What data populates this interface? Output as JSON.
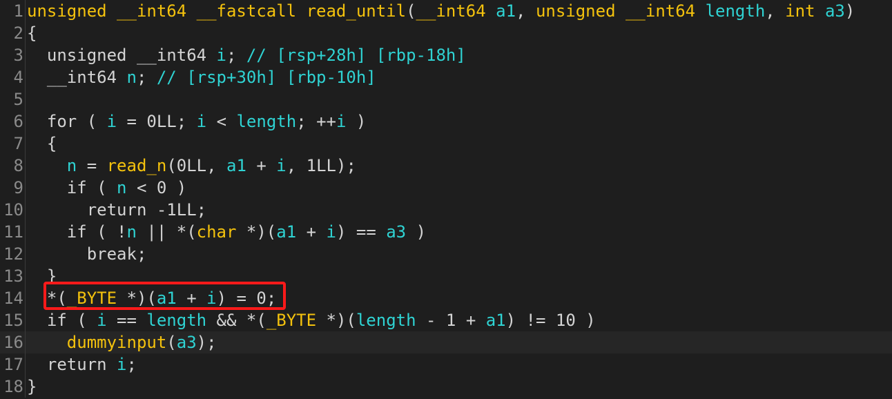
{
  "lines": [
    {
      "num": "1",
      "tokens": [
        [
          "t",
          "unsigned __int64 __fastcall read_until"
        ],
        [
          "p",
          "("
        ],
        [
          "t",
          "__int64 "
        ],
        [
          "v",
          "a1"
        ],
        [
          "p",
          ", "
        ],
        [
          "t",
          "unsigned __int64 "
        ],
        [
          "v",
          "length"
        ],
        [
          "p",
          ", "
        ],
        [
          "t",
          "int "
        ],
        [
          "v",
          "a3"
        ],
        [
          "p",
          ")"
        ]
      ]
    },
    {
      "num": "2",
      "tokens": [
        [
          "p",
          "{"
        ]
      ]
    },
    {
      "num": "3",
      "tokens": [
        [
          "k",
          "  unsigned __int64 "
        ],
        [
          "v",
          "i"
        ],
        [
          "p",
          "; "
        ],
        [
          "c",
          "// [rsp+28h] [rbp-18h]"
        ]
      ]
    },
    {
      "num": "4",
      "tokens": [
        [
          "k",
          "  __int64 "
        ],
        [
          "v",
          "n"
        ],
        [
          "p",
          "; "
        ],
        [
          "c",
          "// [rsp+30h] [rbp-10h]"
        ]
      ]
    },
    {
      "num": "5",
      "tokens": []
    },
    {
      "num": "6",
      "tokens": [
        [
          "k",
          "  for ( "
        ],
        [
          "v",
          "i"
        ],
        [
          "p",
          " = "
        ],
        [
          "n",
          "0LL"
        ],
        [
          "p",
          "; "
        ],
        [
          "v",
          "i"
        ],
        [
          "p",
          " < "
        ],
        [
          "v",
          "length"
        ],
        [
          "p",
          "; ++"
        ],
        [
          "v",
          "i"
        ],
        [
          "p",
          " )"
        ]
      ]
    },
    {
      "num": "7",
      "tokens": [
        [
          "p",
          "  {"
        ]
      ]
    },
    {
      "num": "8",
      "tokens": [
        [
          "p",
          "    "
        ],
        [
          "v",
          "n"
        ],
        [
          "p",
          " = "
        ],
        [
          "t",
          "read_n"
        ],
        [
          "p",
          "("
        ],
        [
          "n",
          "0LL"
        ],
        [
          "p",
          ", "
        ],
        [
          "v",
          "a1"
        ],
        [
          "p",
          " + "
        ],
        [
          "v",
          "i"
        ],
        [
          "p",
          ", "
        ],
        [
          "n",
          "1LL"
        ],
        [
          "p",
          ");"
        ]
      ]
    },
    {
      "num": "9",
      "tokens": [
        [
          "k",
          "    if ( "
        ],
        [
          "v",
          "n"
        ],
        [
          "p",
          " < "
        ],
        [
          "n",
          "0"
        ],
        [
          "p",
          " )"
        ]
      ]
    },
    {
      "num": "10",
      "tokens": [
        [
          "k",
          "      return "
        ],
        [
          "n",
          "-1LL"
        ],
        [
          "p",
          ";"
        ]
      ]
    },
    {
      "num": "11",
      "tokens": [
        [
          "k",
          "    if ( !"
        ],
        [
          "v",
          "n"
        ],
        [
          "p",
          " || *("
        ],
        [
          "t",
          "char"
        ],
        [
          "p",
          " *)("
        ],
        [
          "v",
          "a1"
        ],
        [
          "p",
          " + "
        ],
        [
          "v",
          "i"
        ],
        [
          "p",
          ") == "
        ],
        [
          "v",
          "a3"
        ],
        [
          "p",
          " )"
        ]
      ]
    },
    {
      "num": "12",
      "tokens": [
        [
          "k",
          "      break"
        ],
        [
          "p",
          ";"
        ]
      ]
    },
    {
      "num": "13",
      "tokens": [
        [
          "p",
          "  }"
        ]
      ]
    },
    {
      "num": "14",
      "tokens": [
        [
          "p",
          "  *("
        ],
        [
          "t",
          "_BYTE"
        ],
        [
          "p",
          " *)("
        ],
        [
          "v",
          "a1"
        ],
        [
          "p",
          " + "
        ],
        [
          "v",
          "i"
        ],
        [
          "p",
          ") = "
        ],
        [
          "n",
          "0"
        ],
        [
          "p",
          ";"
        ]
      ]
    },
    {
      "num": "15",
      "tokens": [
        [
          "k",
          "  if ( "
        ],
        [
          "v",
          "i"
        ],
        [
          "p",
          " == "
        ],
        [
          "v",
          "length"
        ],
        [
          "p",
          " && *("
        ],
        [
          "t",
          "_BYTE"
        ],
        [
          "p",
          " *)("
        ],
        [
          "v",
          "length"
        ],
        [
          "p",
          " - "
        ],
        [
          "n",
          "1"
        ],
        [
          "p",
          " + "
        ],
        [
          "v",
          "a1"
        ],
        [
          "p",
          ") != "
        ],
        [
          "n",
          "10"
        ],
        [
          "p",
          " )"
        ]
      ]
    },
    {
      "num": "16",
      "tokens": [
        [
          "p",
          "    "
        ],
        [
          "t",
          "dummyinput"
        ],
        [
          "p",
          "("
        ],
        [
          "v",
          "a3"
        ],
        [
          "p",
          ");"
        ]
      ]
    },
    {
      "num": "17",
      "tokens": [
        [
          "k",
          "  return "
        ],
        [
          "v",
          "i"
        ],
        [
          "p",
          ";"
        ]
      ]
    },
    {
      "num": "18",
      "tokens": [
        [
          "p",
          "}"
        ]
      ]
    }
  ],
  "current_line": 16,
  "highlight_line": 14,
  "colors": {
    "background": "#1e1e1e",
    "type": "#f4c20d",
    "variable": "#2fd3d3",
    "text": "#d4d4d4",
    "highlight_box": "#ff1a1a"
  }
}
